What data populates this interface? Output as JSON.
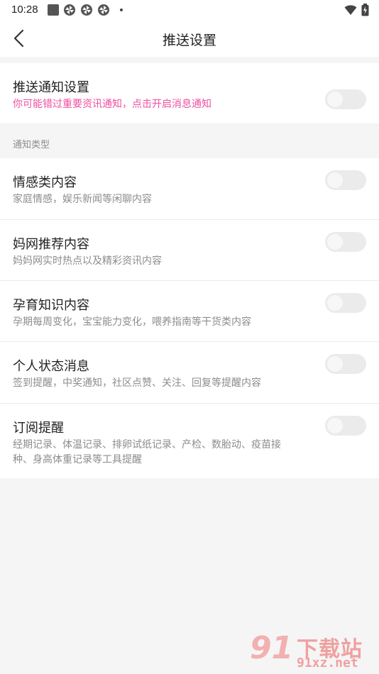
{
  "status_bar": {
    "time": "10:28",
    "icons": [
      "square-notification-icon",
      "pinwheel-icon",
      "pinwheel-icon",
      "pinwheel-icon",
      "dot-icon",
      "wifi-icon",
      "battery-charging-icon"
    ]
  },
  "header": {
    "title": "推送设置",
    "back_icon": "chevron-left-icon"
  },
  "push_setting": {
    "title": "推送通知设置",
    "desc": "你可能错过重要资讯通知，点击开启消息通知",
    "enabled": false
  },
  "section": {
    "label": "通知类型"
  },
  "notification_types": [
    {
      "title": "情感类内容",
      "desc": "家庭情感，娱乐新闻等闲聊内容",
      "enabled": false
    },
    {
      "title": "妈网推荐内容",
      "desc": "妈妈网实时热点以及精彩资讯内容",
      "enabled": false
    },
    {
      "title": "孕育知识内容",
      "desc": "孕期每周变化，宝宝能力变化，喂养指南等干货类内容",
      "enabled": false
    },
    {
      "title": "个人状态消息",
      "desc": "签到提醒，中奖通知，社区点赞、关注、回复等提醒内容",
      "enabled": false
    },
    {
      "title": "订阅提醒",
      "desc_line1": "经期记录、体温记录、排卵试纸记录、产检、数胎动、疫苗接",
      "desc_line2": "种、身高体重记录等工具提醒",
      "enabled": false
    }
  ],
  "watermark": {
    "logo": "91",
    "text": "下载站",
    "url": "91xz.net"
  },
  "colors": {
    "accent_pink": "#f04fa0",
    "background": "#f5f5f5",
    "toggle_off": "#ebebeb"
  }
}
